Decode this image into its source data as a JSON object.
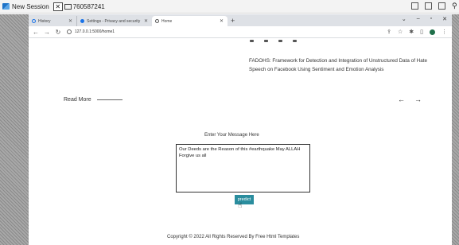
{
  "session": {
    "title": "New Session",
    "close": "✕",
    "id": "760587241"
  },
  "browser": {
    "tabs": [
      {
        "label": "History"
      },
      {
        "label": "Settings - Privacy and security"
      },
      {
        "label": "Home"
      }
    ],
    "url": "127.0.0.1:5000/home1"
  },
  "page": {
    "article_text": "FADOHS: Framework for Detection and Integration of Unstructured Data of Hate Speech on Facebook Using Sentiment and Emotion Analysis",
    "read_more": "Read More",
    "arrow_left": "←",
    "arrow_right": "→",
    "message_label": "Enter Your Message Here",
    "message_value": "Our Deeds are the Reason of this #earthquake May ALLAH Forgive us all",
    "predict_label": "predict",
    "footer": "Copyright © 2022 All Rights Reserved By Free Html Templates"
  },
  "colors": {
    "predict_bg": "#2a8d9e"
  }
}
